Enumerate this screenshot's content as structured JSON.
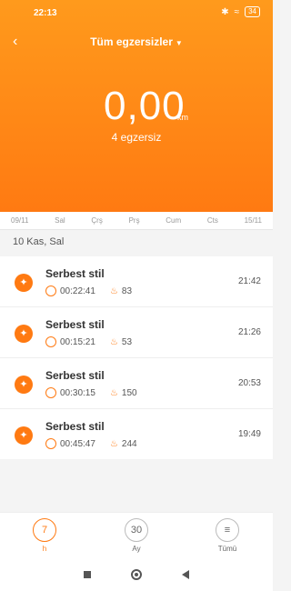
{
  "status": {
    "time": "22:13",
    "battery": "34"
  },
  "header": {
    "title": "Tüm egzersizler",
    "distance_value": "0,00",
    "distance_unit": "km",
    "subtitle": "4 egzersiz"
  },
  "days": [
    "09/11",
    "Sal",
    "Çrş",
    "Prş",
    "Cum",
    "Cts",
    "15/11"
  ],
  "date_label": "10 Kas, Sal",
  "workouts": [
    {
      "name": "Serbest stil",
      "duration": "00:22:41",
      "calories": "83",
      "time": "21:42"
    },
    {
      "name": "Serbest stil",
      "duration": "00:15:21",
      "calories": "53",
      "time": "21:26"
    },
    {
      "name": "Serbest stil",
      "duration": "00:30:15",
      "calories": "150",
      "time": "20:53"
    },
    {
      "name": "Serbest stil",
      "duration": "00:45:47",
      "calories": "244",
      "time": "19:49"
    }
  ],
  "bottom_nav": [
    {
      "number": "7",
      "label": "h"
    },
    {
      "number": "30",
      "label": "Ay"
    },
    {
      "number": "",
      "label": "Tümü"
    }
  ],
  "colors": {
    "accent": "#ff7a12",
    "background": "#f4f4f4"
  }
}
